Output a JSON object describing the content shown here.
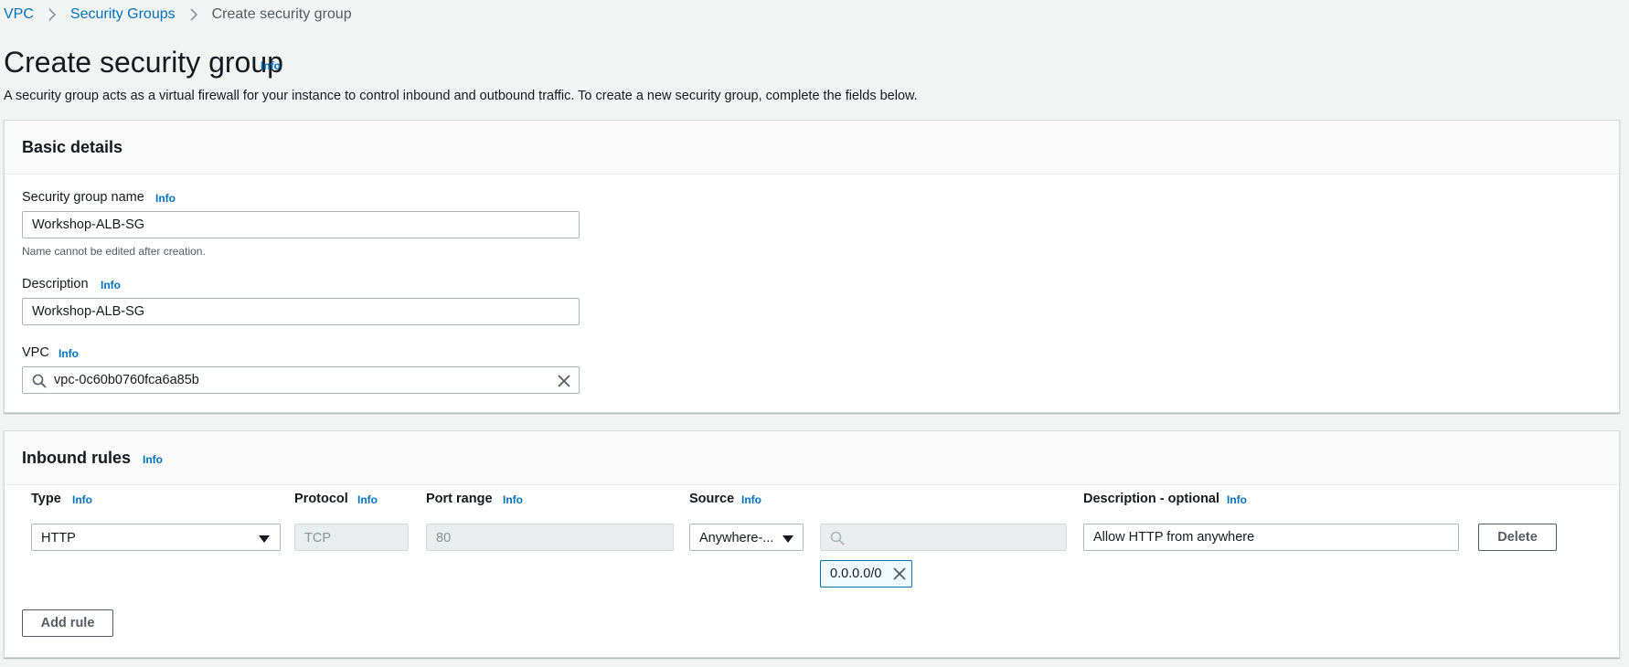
{
  "breadcrumb": {
    "items": [
      {
        "label": "VPC"
      },
      {
        "label": "Security Groups"
      }
    ],
    "current": "Create security group"
  },
  "page": {
    "title": "Create security group",
    "info": "Info",
    "description": "A security group acts as a virtual firewall for your instance to control inbound and outbound traffic. To create a new security group, complete the fields below."
  },
  "basic_details": {
    "title": "Basic details",
    "name_label": "Security group name",
    "name_info": "Info",
    "name_value": "Workshop-ALB-SG",
    "name_hint": "Name cannot be edited after creation.",
    "description_label": "Description",
    "description_info": "Info",
    "description_value": "Workshop-ALB-SG",
    "vpc_label": "VPC",
    "vpc_info": "Info",
    "vpc_value": "vpc-0c60b0760fca6a85b"
  },
  "inbound_rules": {
    "title": "Inbound rules",
    "info": "Info",
    "columns": {
      "type": "Type",
      "protocol": "Protocol",
      "port_range": "Port range",
      "source": "Source",
      "description": "Description - optional",
      "info": "Info"
    },
    "rule": {
      "type": "HTTP",
      "protocol": "TCP",
      "port_range": "80",
      "source_type": "Anywhere-...",
      "source_search_value": "",
      "source_token": "0.0.0.0/0",
      "description": "Allow HTTP from anywhere",
      "delete_label": "Delete"
    },
    "add_rule_label": "Add rule"
  },
  "icons": {
    "breadcrumb_separator": "chevron-right-icon",
    "search": "search-icon",
    "clear": "close-icon",
    "dropdown": "caret-down-icon"
  },
  "colors": {
    "link": "#0073bb",
    "background": "#f2f3f3",
    "panel_header": "#fafafa",
    "token_border": "#0073bb"
  }
}
